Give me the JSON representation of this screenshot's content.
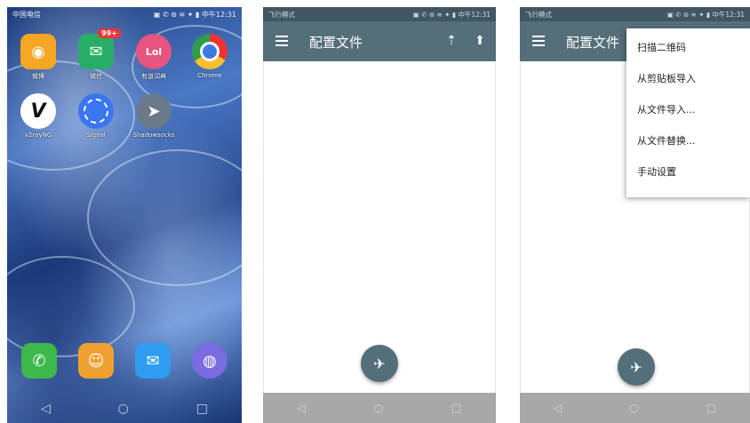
{
  "home": {
    "status": {
      "left": "中国电信",
      "right": "▣ ✆ ⊛ ≋ ✦ ▮ 中午12:31"
    },
    "apps": [
      {
        "label": "微博",
        "color": "#f5a623",
        "glyph": "◉"
      },
      {
        "label": "微信",
        "color": "#2aae67",
        "glyph": "✉",
        "badge": "99+"
      },
      {
        "label": "有道词典",
        "color": "#e75480",
        "glyph": "Lol"
      },
      {
        "label": "Chrome",
        "color": "#3b7be0",
        "glyph": "◎"
      },
      {
        "label": "v2rayNG",
        "color": "#ffffff",
        "glyph": "V"
      },
      {
        "label": "Signal",
        "color": "#3a76f0",
        "glyph": "◯"
      },
      {
        "label": "Shadowsocks",
        "color": "#6b7a8a",
        "glyph": "➤"
      }
    ],
    "dock": [
      {
        "color": "#3cb94a",
        "glyph": "✆"
      },
      {
        "color": "#f0a030",
        "glyph": "☺"
      },
      {
        "color": "#2e9cf0",
        "glyph": "✉"
      },
      {
        "color": "#7a6be0",
        "glyph": "◍"
      }
    ],
    "nav": [
      "◁",
      "○",
      "□"
    ]
  },
  "app2": {
    "status": {
      "left": "飞行模式",
      "right": "▣ ✆ ⊛ ≋ ✦ ▮ 中午12:31"
    },
    "title": "配置文件",
    "actions": [
      "⇡",
      "⬆"
    ],
    "fab_glyph": "✈",
    "nav": [
      "◁",
      "○",
      "□"
    ]
  },
  "app3": {
    "status": {
      "left": "飞行模式",
      "right": "▣ ✆ ⊛ ≋ ✦ ▮ 中午12:31"
    },
    "title": "配置文件",
    "menu": [
      "扫描二维码",
      "从剪贴板导入",
      "从文件导入...",
      "从文件替换...",
      "手动设置"
    ],
    "fab_glyph": "✈",
    "nav": [
      "◁",
      "○",
      "□"
    ]
  },
  "colors": {
    "toolbar": "#546e7a",
    "statusbar": "#3f5663",
    "navbar": "#a8a8a8"
  }
}
